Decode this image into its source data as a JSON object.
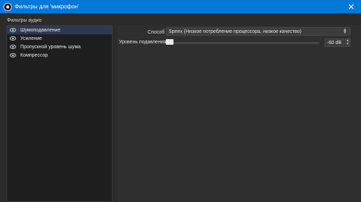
{
  "window": {
    "title": "Фильтры для 'микрофон'",
    "close_glyph": "✕",
    "titlebar_color": "#0078d7"
  },
  "filters_panel": {
    "group_label": "Фильтры аудио",
    "items": [
      {
        "label": "Шумоподавление",
        "selected": true
      },
      {
        "label": "Усиление",
        "selected": false
      },
      {
        "label": "Пропускной уровень шума",
        "selected": false
      },
      {
        "label": "Компрессор",
        "selected": false
      }
    ]
  },
  "properties": {
    "method_label": "Способ",
    "method_value": "Speex (Низкое потребление процессора, низкое качество)",
    "suppress_label": "Уровень подавления",
    "suppress_value": "-60 dB",
    "suppress_level_fraction": 0.0
  }
}
